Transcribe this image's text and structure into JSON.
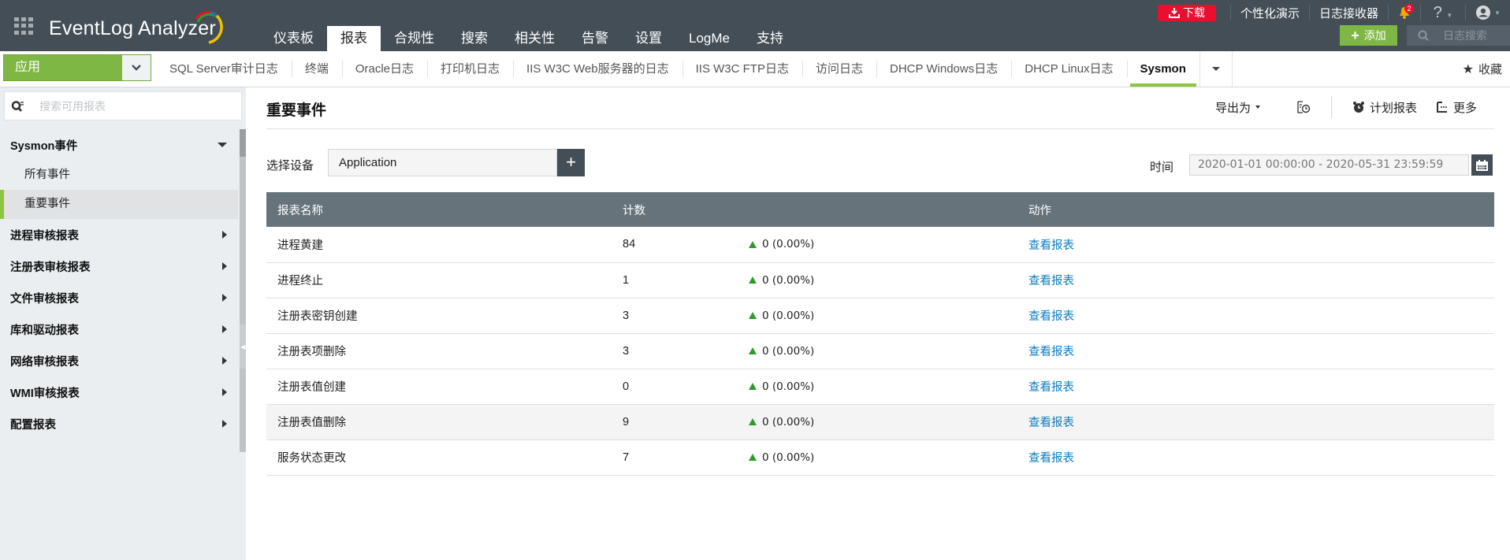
{
  "app": {
    "name": "EventLog Analyzer"
  },
  "topbar": {
    "download_label": "下载",
    "personalize_demo": "个性化演示",
    "log_receiver": "日志接收器",
    "notification_count": "2",
    "help_label": "?",
    "add_label": "添加",
    "log_search_placeholder": "日志搜索"
  },
  "main_nav": [
    {
      "label": "仪表板",
      "active": false
    },
    {
      "label": "报表",
      "active": true
    },
    {
      "label": "合规性",
      "active": false
    },
    {
      "label": "搜索",
      "active": false
    },
    {
      "label": "相关性",
      "active": false
    },
    {
      "label": "告警",
      "active": false
    },
    {
      "label": "设置",
      "active": false
    },
    {
      "label": "LogMe",
      "active": false
    },
    {
      "label": "支持",
      "active": false
    }
  ],
  "subbar": {
    "app_select": "应用",
    "tabs": [
      {
        "label": "SQL Server审计日志",
        "active": false
      },
      {
        "label": "终端",
        "active": false
      },
      {
        "label": "Oracle日志",
        "active": false
      },
      {
        "label": "打印机日志",
        "active": false
      },
      {
        "label": "IIS W3C Web服务器的日志",
        "active": false
      },
      {
        "label": "IIS W3C FTP日志",
        "active": false
      },
      {
        "label": "访问日志",
        "active": false
      },
      {
        "label": "DHCP Windows日志",
        "active": false
      },
      {
        "label": "DHCP Linux日志",
        "active": false
      },
      {
        "label": "Sysmon",
        "active": true
      }
    ],
    "favorites_label": "收藏"
  },
  "sidebar": {
    "search_placeholder": "搜索可用报表",
    "expanded_group": {
      "label": "Sysmon事件",
      "items": [
        {
          "label": "所有事件",
          "active": false
        },
        {
          "label": "重要事件",
          "active": true
        }
      ]
    },
    "groups": [
      {
        "label": "进程审核报表"
      },
      {
        "label": "注册表审核报表"
      },
      {
        "label": "文件审核报表"
      },
      {
        "label": "库和驱动报表"
      },
      {
        "label": "网络审核报表"
      },
      {
        "label": "WMI审核报表"
      },
      {
        "label": "配置报表"
      }
    ]
  },
  "content": {
    "title": "重要事件",
    "toolbar": {
      "export_label": "导出为",
      "schedule_label": "计划报表",
      "more_label": "更多"
    },
    "device_label": "选择设备",
    "device_value": "Application",
    "time_label": "时间",
    "time_range": "2020-01-01 00:00:00 - 2020-05-31 23:59:59",
    "table": {
      "headers": {
        "name": "报表名称",
        "count": "计数",
        "trend": "",
        "action": "动作"
      },
      "rows": [
        {
          "name": "进程黄建",
          "count": "84",
          "trend": "0 (0.00%)",
          "action": "查看报表"
        },
        {
          "name": "进程终止",
          "count": "1",
          "trend": "0 (0.00%)",
          "action": "查看报表"
        },
        {
          "name": "注册表密钥创建",
          "count": "3",
          "trend": "0 (0.00%)",
          "action": "查看报表"
        },
        {
          "name": "注册表项删除",
          "count": "3",
          "trend": "0 (0.00%)",
          "action": "查看报表"
        },
        {
          "name": "注册表值创建",
          "count": "0",
          "trend": "0 (0.00%)",
          "action": "查看报表"
        },
        {
          "name": "注册表值删除",
          "count": "9",
          "trend": "0 (0.00%)",
          "action": "查看报表"
        },
        {
          "name": "服务状态更改",
          "count": "7",
          "trend": "0 (0.00%)",
          "action": "查看报表"
        }
      ]
    }
  },
  "colors": {
    "topbar_bg": "#434e57",
    "accent_green": "#7fb744",
    "download_red": "#e8102e",
    "table_header": "#67737b",
    "link_blue": "#0a7bc1",
    "trend_up_green": "#2e9b2e"
  }
}
